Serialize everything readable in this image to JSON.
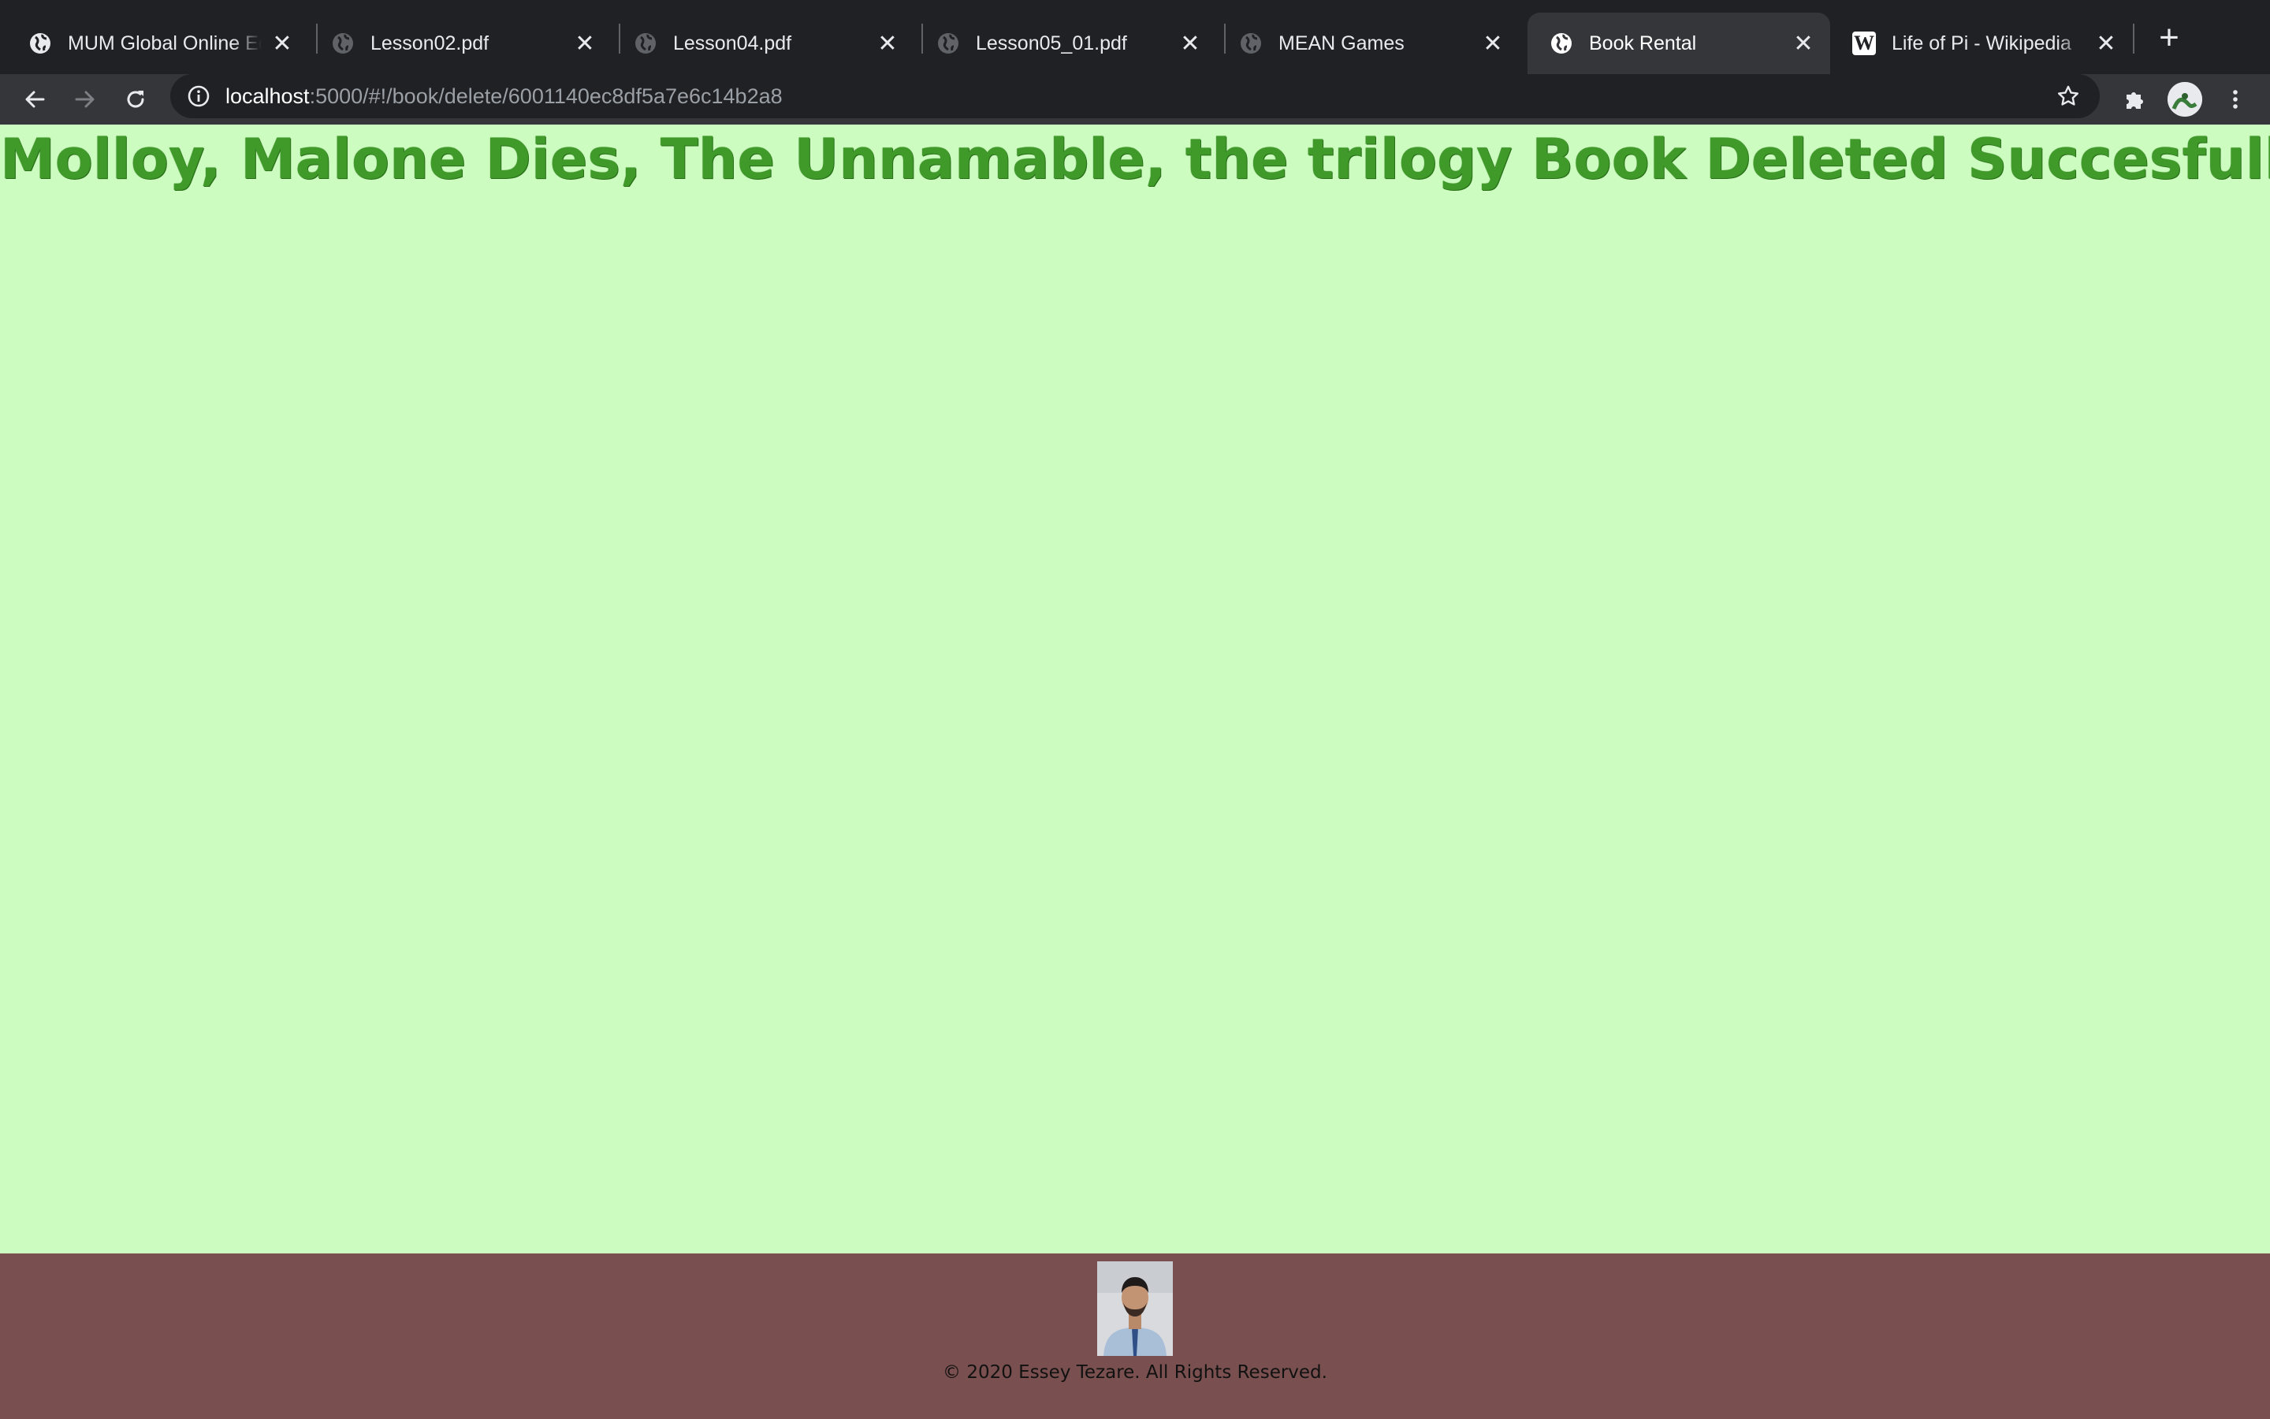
{
  "browser": {
    "tabs": [
      {
        "title": "MUM Global Online Ed",
        "favicon": "globe-icon",
        "active": false
      },
      {
        "title": "Lesson02.pdf",
        "favicon": "globe-icon",
        "active": false
      },
      {
        "title": "Lesson04.pdf",
        "favicon": "globe-icon",
        "active": false
      },
      {
        "title": "Lesson05_01.pdf",
        "favicon": "globe-icon",
        "active": false
      },
      {
        "title": "MEAN Games",
        "favicon": "globe-icon",
        "active": false
      },
      {
        "title": "Book Rental",
        "favicon": "globe-icon",
        "active": true
      },
      {
        "title": "Life of Pi - Wikipedia",
        "favicon": "wikipedia-icon",
        "active": false
      }
    ],
    "close_glyph": "✕",
    "new_tab_glyph": "+",
    "wiki_letter": "W",
    "url_host": "localhost",
    "url_rest": ":5000/#!/book/delete/6001140ec8df5a7e6c14b2a8"
  },
  "page": {
    "message": "Molloy, Malone Dies, The Unnamable, the trilogy Book Deleted Succesfully"
  },
  "footer": {
    "copyright": "© 2020 Essey Tezare. All Rights Reserved."
  },
  "colors": {
    "page_background": "#ccfcbf",
    "heading": "#3f9a2a",
    "footer_background": "#79504f"
  }
}
